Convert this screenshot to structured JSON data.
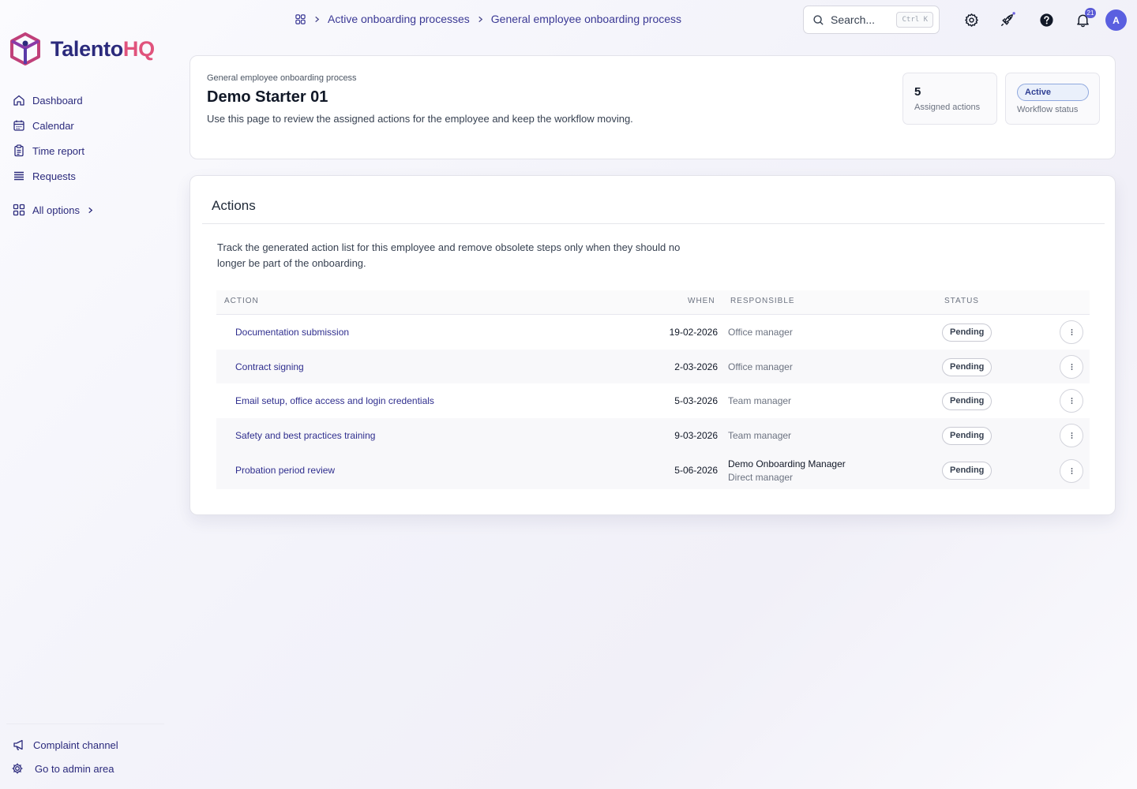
{
  "brand": {
    "name_part1": "Talento",
    "name_part2": "HQ"
  },
  "sidebar": {
    "items": [
      {
        "label": "Dashboard",
        "icon": "home-icon"
      },
      {
        "label": "Calendar",
        "icon": "calendar-icon"
      },
      {
        "label": "Time report",
        "icon": "clipboard-icon"
      },
      {
        "label": "Requests",
        "icon": "list-icon"
      },
      {
        "label": "All options",
        "icon": "grid-icon"
      }
    ],
    "footer": {
      "complaint": "Complaint channel",
      "admin": "Go to admin area"
    }
  },
  "breadcrumb": {
    "items": [
      "Active onboarding processes",
      "General employee onboarding process"
    ]
  },
  "topbar": {
    "search_placeholder": "Search...",
    "search_shortcut": "Ctrl K",
    "notification_count": "21",
    "avatar_initial": "A"
  },
  "header": {
    "subtitle": "General employee onboarding process",
    "title": "Demo Starter 01",
    "description": "Use this page to review the assigned actions for the employee and keep the workflow moving.",
    "assigned_count": "5",
    "assigned_label": "Assigned actions",
    "status_value": "Active",
    "status_label": "Workflow status"
  },
  "actions": {
    "title": "Actions",
    "description": "Track the generated action list for this employee and remove obsolete steps only when they should no longer be part of the onboarding.",
    "columns": {
      "action": "ACTION",
      "when": "WHEN",
      "responsible": "RESPONSIBLE",
      "status": "STATUS"
    },
    "rows": [
      {
        "action": "Documentation submission",
        "when": "19-02-2026",
        "responsible": "Office manager",
        "status": "Pending"
      },
      {
        "action": "Contract signing",
        "when": "2-03-2026",
        "responsible": "Office manager",
        "status": "Pending"
      },
      {
        "action": "Email setup, office access and login credentials",
        "when": "5-03-2026",
        "responsible": "Team manager",
        "status": "Pending"
      },
      {
        "action": "Safety and best practices training",
        "when": "9-03-2026",
        "responsible": "Team manager",
        "status": "Pending"
      },
      {
        "action": "Probation period review",
        "when": "5-06-2026",
        "responsible_name": "Demo Onboarding Manager",
        "responsible": "Direct manager",
        "status": "Pending"
      }
    ]
  },
  "colors": {
    "accent": "#2b2a7c",
    "brand_pink": "#e0537c",
    "avatar": "#5a5fe0"
  }
}
